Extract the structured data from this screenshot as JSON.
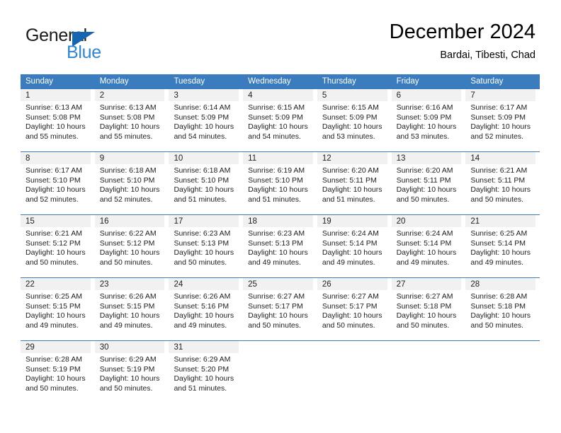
{
  "brand": {
    "name_top": "General",
    "name_bottom": "Blue",
    "accent_color": "#2f86d3",
    "triangle_color": "#1565b0"
  },
  "header": {
    "title": "December 2024",
    "subtitle": "Bardai, Tibesti, Chad"
  },
  "theme": {
    "header_row_bg": "#3a7cbe",
    "header_row_text": "#ffffff",
    "day_band_bg": "#f1f1f1",
    "row_divider": "#3a7cbe"
  },
  "weekdays": [
    "Sunday",
    "Monday",
    "Tuesday",
    "Wednesday",
    "Thursday",
    "Friday",
    "Saturday"
  ],
  "labels": {
    "sunrise_prefix": "Sunrise:",
    "sunset_prefix": "Sunset:",
    "daylight_prefix": "Daylight:"
  },
  "weeks": [
    [
      {
        "day": "1",
        "sunrise": "Sunrise: 6:13 AM",
        "sunset": "Sunset: 5:08 PM",
        "daylight_line1": "Daylight: 10 hours",
        "daylight_line2": "and 55 minutes."
      },
      {
        "day": "2",
        "sunrise": "Sunrise: 6:13 AM",
        "sunset": "Sunset: 5:08 PM",
        "daylight_line1": "Daylight: 10 hours",
        "daylight_line2": "and 55 minutes."
      },
      {
        "day": "3",
        "sunrise": "Sunrise: 6:14 AM",
        "sunset": "Sunset: 5:09 PM",
        "daylight_line1": "Daylight: 10 hours",
        "daylight_line2": "and 54 minutes."
      },
      {
        "day": "4",
        "sunrise": "Sunrise: 6:15 AM",
        "sunset": "Sunset: 5:09 PM",
        "daylight_line1": "Daylight: 10 hours",
        "daylight_line2": "and 54 minutes."
      },
      {
        "day": "5",
        "sunrise": "Sunrise: 6:15 AM",
        "sunset": "Sunset: 5:09 PM",
        "daylight_line1": "Daylight: 10 hours",
        "daylight_line2": "and 53 minutes."
      },
      {
        "day": "6",
        "sunrise": "Sunrise: 6:16 AM",
        "sunset": "Sunset: 5:09 PM",
        "daylight_line1": "Daylight: 10 hours",
        "daylight_line2": "and 53 minutes."
      },
      {
        "day": "7",
        "sunrise": "Sunrise: 6:17 AM",
        "sunset": "Sunset: 5:09 PM",
        "daylight_line1": "Daylight: 10 hours",
        "daylight_line2": "and 52 minutes."
      }
    ],
    [
      {
        "day": "8",
        "sunrise": "Sunrise: 6:17 AM",
        "sunset": "Sunset: 5:10 PM",
        "daylight_line1": "Daylight: 10 hours",
        "daylight_line2": "and 52 minutes."
      },
      {
        "day": "9",
        "sunrise": "Sunrise: 6:18 AM",
        "sunset": "Sunset: 5:10 PM",
        "daylight_line1": "Daylight: 10 hours",
        "daylight_line2": "and 52 minutes."
      },
      {
        "day": "10",
        "sunrise": "Sunrise: 6:18 AM",
        "sunset": "Sunset: 5:10 PM",
        "daylight_line1": "Daylight: 10 hours",
        "daylight_line2": "and 51 minutes."
      },
      {
        "day": "11",
        "sunrise": "Sunrise: 6:19 AM",
        "sunset": "Sunset: 5:10 PM",
        "daylight_line1": "Daylight: 10 hours",
        "daylight_line2": "and 51 minutes."
      },
      {
        "day": "12",
        "sunrise": "Sunrise: 6:20 AM",
        "sunset": "Sunset: 5:11 PM",
        "daylight_line1": "Daylight: 10 hours",
        "daylight_line2": "and 51 minutes."
      },
      {
        "day": "13",
        "sunrise": "Sunrise: 6:20 AM",
        "sunset": "Sunset: 5:11 PM",
        "daylight_line1": "Daylight: 10 hours",
        "daylight_line2": "and 50 minutes."
      },
      {
        "day": "14",
        "sunrise": "Sunrise: 6:21 AM",
        "sunset": "Sunset: 5:11 PM",
        "daylight_line1": "Daylight: 10 hours",
        "daylight_line2": "and 50 minutes."
      }
    ],
    [
      {
        "day": "15",
        "sunrise": "Sunrise: 6:21 AM",
        "sunset": "Sunset: 5:12 PM",
        "daylight_line1": "Daylight: 10 hours",
        "daylight_line2": "and 50 minutes."
      },
      {
        "day": "16",
        "sunrise": "Sunrise: 6:22 AM",
        "sunset": "Sunset: 5:12 PM",
        "daylight_line1": "Daylight: 10 hours",
        "daylight_line2": "and 50 minutes."
      },
      {
        "day": "17",
        "sunrise": "Sunrise: 6:23 AM",
        "sunset": "Sunset: 5:13 PM",
        "daylight_line1": "Daylight: 10 hours",
        "daylight_line2": "and 50 minutes."
      },
      {
        "day": "18",
        "sunrise": "Sunrise: 6:23 AM",
        "sunset": "Sunset: 5:13 PM",
        "daylight_line1": "Daylight: 10 hours",
        "daylight_line2": "and 49 minutes."
      },
      {
        "day": "19",
        "sunrise": "Sunrise: 6:24 AM",
        "sunset": "Sunset: 5:14 PM",
        "daylight_line1": "Daylight: 10 hours",
        "daylight_line2": "and 49 minutes."
      },
      {
        "day": "20",
        "sunrise": "Sunrise: 6:24 AM",
        "sunset": "Sunset: 5:14 PM",
        "daylight_line1": "Daylight: 10 hours",
        "daylight_line2": "and 49 minutes."
      },
      {
        "day": "21",
        "sunrise": "Sunrise: 6:25 AM",
        "sunset": "Sunset: 5:14 PM",
        "daylight_line1": "Daylight: 10 hours",
        "daylight_line2": "and 49 minutes."
      }
    ],
    [
      {
        "day": "22",
        "sunrise": "Sunrise: 6:25 AM",
        "sunset": "Sunset: 5:15 PM",
        "daylight_line1": "Daylight: 10 hours",
        "daylight_line2": "and 49 minutes."
      },
      {
        "day": "23",
        "sunrise": "Sunrise: 6:26 AM",
        "sunset": "Sunset: 5:15 PM",
        "daylight_line1": "Daylight: 10 hours",
        "daylight_line2": "and 49 minutes."
      },
      {
        "day": "24",
        "sunrise": "Sunrise: 6:26 AM",
        "sunset": "Sunset: 5:16 PM",
        "daylight_line1": "Daylight: 10 hours",
        "daylight_line2": "and 49 minutes."
      },
      {
        "day": "25",
        "sunrise": "Sunrise: 6:27 AM",
        "sunset": "Sunset: 5:17 PM",
        "daylight_line1": "Daylight: 10 hours",
        "daylight_line2": "and 50 minutes."
      },
      {
        "day": "26",
        "sunrise": "Sunrise: 6:27 AM",
        "sunset": "Sunset: 5:17 PM",
        "daylight_line1": "Daylight: 10 hours",
        "daylight_line2": "and 50 minutes."
      },
      {
        "day": "27",
        "sunrise": "Sunrise: 6:27 AM",
        "sunset": "Sunset: 5:18 PM",
        "daylight_line1": "Daylight: 10 hours",
        "daylight_line2": "and 50 minutes."
      },
      {
        "day": "28",
        "sunrise": "Sunrise: 6:28 AM",
        "sunset": "Sunset: 5:18 PM",
        "daylight_line1": "Daylight: 10 hours",
        "daylight_line2": "and 50 minutes."
      }
    ],
    [
      {
        "day": "29",
        "sunrise": "Sunrise: 6:28 AM",
        "sunset": "Sunset: 5:19 PM",
        "daylight_line1": "Daylight: 10 hours",
        "daylight_line2": "and 50 minutes."
      },
      {
        "day": "30",
        "sunrise": "Sunrise: 6:29 AM",
        "sunset": "Sunset: 5:19 PM",
        "daylight_line1": "Daylight: 10 hours",
        "daylight_line2": "and 50 minutes."
      },
      {
        "day": "31",
        "sunrise": "Sunrise: 6:29 AM",
        "sunset": "Sunset: 5:20 PM",
        "daylight_line1": "Daylight: 10 hours",
        "daylight_line2": "and 51 minutes."
      },
      {
        "day": "",
        "sunrise": "",
        "sunset": "",
        "daylight_line1": "",
        "daylight_line2": ""
      },
      {
        "day": "",
        "sunrise": "",
        "sunset": "",
        "daylight_line1": "",
        "daylight_line2": ""
      },
      {
        "day": "",
        "sunrise": "",
        "sunset": "",
        "daylight_line1": "",
        "daylight_line2": ""
      },
      {
        "day": "",
        "sunrise": "",
        "sunset": "",
        "daylight_line1": "",
        "daylight_line2": ""
      }
    ]
  ]
}
